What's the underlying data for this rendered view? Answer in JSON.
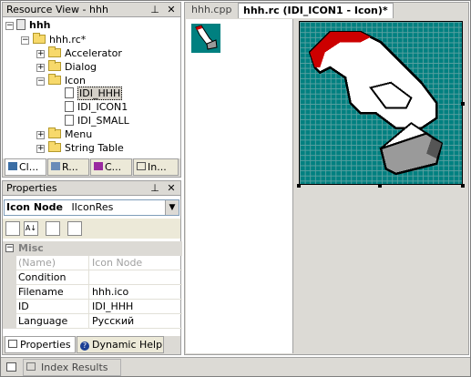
{
  "resource_view": {
    "title": "Resource View - hhh",
    "pin": "⊥",
    "close": "✕",
    "tree": {
      "root": "hhh",
      "rc": "hhh.rc*",
      "accelerator": "Accelerator",
      "dialog": "Dialog",
      "icon": "Icon",
      "icon_items": [
        "IDI_HHH",
        "IDI_ICON1",
        "IDI_SMALL"
      ],
      "menu": "Menu",
      "string_table": "String Table"
    },
    "tabs": [
      "Cl...",
      "R...",
      "C...",
      "In..."
    ]
  },
  "properties": {
    "title": "Properties",
    "pin": "⊥",
    "close": "✕",
    "object_name": "Icon Node",
    "object_type": "IIconRes",
    "category": "Misc",
    "rows": [
      {
        "key": "(Name)",
        "value": "Icon Node",
        "disabled": true
      },
      {
        "key": "Condition",
        "value": "",
        "disabled": false
      },
      {
        "key": "Filename",
        "value": "hhh.ico",
        "disabled": false
      },
      {
        "key": "ID",
        "value": "IDI_HHH",
        "disabled": false
      },
      {
        "key": "Language",
        "value": "Русский",
        "disabled": false
      }
    ],
    "bottom_tabs": [
      "Properties",
      "Dynamic Help"
    ]
  },
  "editor": {
    "tabs": [
      "hhh.cpp",
      "hhh.rc (IDI_ICON1 - Icon)*"
    ],
    "active_tab": 1,
    "colors": {
      "teal": "#008080",
      "red": "#cc0000",
      "grid_bg": "#008080"
    }
  },
  "status": {
    "index_results": "Index Results"
  }
}
